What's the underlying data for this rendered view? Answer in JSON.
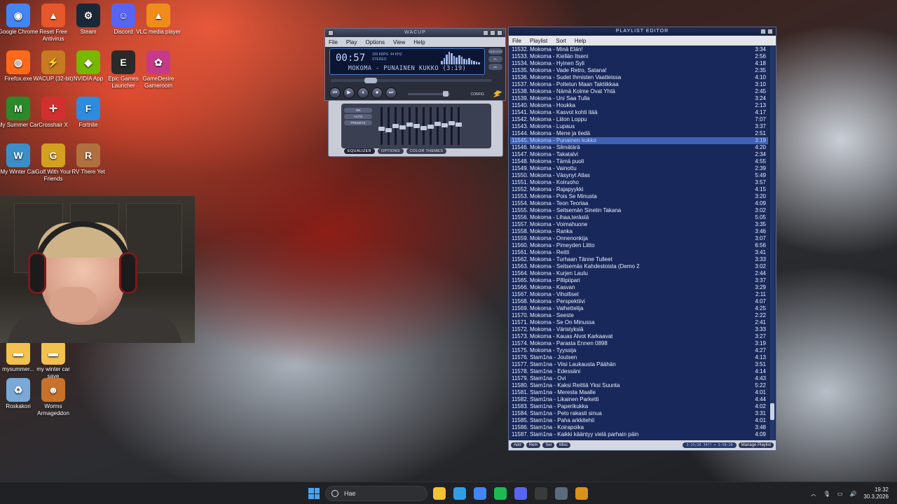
{
  "desktop_icons": [
    {
      "label": "Google Chrome",
      "color": "#4285f4",
      "glyph": "◉"
    },
    {
      "label": "Reset Free Antivirus",
      "color": "#e6572b",
      "glyph": "▲"
    },
    {
      "label": "Steam",
      "color": "#1b2838",
      "glyph": "⚙"
    },
    {
      "label": "Discord",
      "color": "#5865f2",
      "glyph": "☺"
    },
    {
      "label": "VLC media player",
      "color": "#f08c1a",
      "glyph": "▲"
    },
    {
      "label": "Firefox.exe",
      "color": "#ff6a1a",
      "glyph": "◍"
    },
    {
      "label": "WACUP (32-bit)",
      "color": "#c77a20",
      "glyph": "⚡"
    },
    {
      "label": "NVIDIA App",
      "color": "#76b900",
      "glyph": "◆"
    },
    {
      "label": "Epic Games Launcher",
      "color": "#2a2a2a",
      "glyph": "E"
    },
    {
      "label": "GameDesire Gameroom",
      "color": "#c73a8a",
      "glyph": "✿"
    },
    {
      "label": "My Summer Car",
      "color": "#2a8a2a",
      "glyph": "M"
    },
    {
      "label": "Crosshair X",
      "color": "#d23030",
      "glyph": "✛"
    },
    {
      "label": "Fortnite",
      "color": "#2d8be0",
      "glyph": "F"
    },
    {
      "label": "My Winter Car",
      "color": "#3b8fc8",
      "glyph": "W"
    },
    {
      "label": "Golf With Your Friends",
      "color": "#d4a020",
      "glyph": "G"
    },
    {
      "label": "RV There Yet",
      "color": "#b07040",
      "glyph": "R"
    },
    {
      "label": "mysummer...",
      "color": "#f2c14e",
      "glyph": "▬"
    },
    {
      "label": "my winter car save",
      "color": "#f2c14e",
      "glyph": "▬"
    },
    {
      "label": "Roskakori",
      "color": "#7aa9d8",
      "glyph": "♻"
    },
    {
      "label": "Worms Armageddon",
      "color": "#c8712a",
      "glyph": "☻"
    }
  ],
  "winamp": {
    "title": "WACUP",
    "menu": [
      "File",
      "Play",
      "Options",
      "View",
      "Help"
    ],
    "time": "00:57",
    "kbps": "320",
    "khz": "44",
    "mode": "STEREO",
    "song": "MOKOMA - PUNAINEN KUKKO (3:19)",
    "side_buttons": [
      "VIDEO/VIS",
      "PL",
      "ML"
    ],
    "controls": [
      "⏮",
      "▶",
      "⏸",
      "⏹",
      "⏭"
    ],
    "config_label": "CONFIG"
  },
  "equalizer": {
    "left_buttons": [
      "ON",
      "AUTO",
      "PRESETS"
    ],
    "tabs": [
      "EQUALIZER",
      "OPTIONS",
      "COLOR THEMES"
    ]
  },
  "playlist": {
    "title": "PLAYLIST EDITOR",
    "menu": [
      "File",
      "Playlist",
      "Sort",
      "Help"
    ],
    "selected_index": 13,
    "rows": [
      {
        "name": "11532. Mokoma - Minä Elän!",
        "dur": "3:34"
      },
      {
        "name": "11533. Mokoma - Kiellän Itseni",
        "dur": "2:56"
      },
      {
        "name": "11534. Mokoma - Hyinen Syli",
        "dur": "4:18"
      },
      {
        "name": "11535. Mokoma - Vade Retro, Satana!",
        "dur": "2:35"
      },
      {
        "name": "11536. Mokoma - Sudet Ihmisten Vaatteissa",
        "dur": "4:10"
      },
      {
        "name": "11537. Mokoma - Poltetun Maan Taktiikkaa",
        "dur": "3:10"
      },
      {
        "name": "11538. Mokoma - Nämä Kolme Ovat Yhtä",
        "dur": "2:45"
      },
      {
        "name": "11539. Mokoma - Uni Saa Tulla",
        "dur": "3:24"
      },
      {
        "name": "11540. Mokoma - Houkka",
        "dur": "2:13"
      },
      {
        "name": "11541. Mokoma - Kasvot kohti itää",
        "dur": "4:17"
      },
      {
        "name": "11542. Mokoma - Liiton Loppu",
        "dur": "7:07"
      },
      {
        "name": "11543. Mokoma - Lupaus",
        "dur": "3:37"
      },
      {
        "name": "11544. Mokoma - Mene ja tiedä",
        "dur": "2:51"
      },
      {
        "name": "11545. Mokoma - Punainen kukko",
        "dur": "3:19"
      },
      {
        "name": "11546. Mokoma - Silmätärä",
        "dur": "4:20"
      },
      {
        "name": "11547. Mokoma - Takatalvi",
        "dur": "2:34"
      },
      {
        "name": "11548. Mokoma - Tämä puoli",
        "dur": "4:55"
      },
      {
        "name": "11549. Mokoma - Vainottu",
        "dur": "2:39"
      },
      {
        "name": "11550. Mokoma - Väsynyt Atlas",
        "dur": "5:49"
      },
      {
        "name": "11551. Mokoma - Koiruoho",
        "dur": "3:57"
      },
      {
        "name": "11552. Mokoma - Rajapyykki",
        "dur": "4:15"
      },
      {
        "name": "11553. Mokoma - Pois Se Minusta",
        "dur": "3:20"
      },
      {
        "name": "11554. Mokoma - Teon Teoriaa",
        "dur": "4:09"
      },
      {
        "name": "11555. Mokoma - Seitsemän Sinetin Takana",
        "dur": "3:02"
      },
      {
        "name": "11556. Mokoma - Lihaa,terästä",
        "dur": "5:05"
      },
      {
        "name": "11557. Mokoma - Voimahuone",
        "dur": "3:35"
      },
      {
        "name": "11558. Mokoma - Ranka",
        "dur": "3:46"
      },
      {
        "name": "11559. Mokoma - Onnenonkija",
        "dur": "3:07"
      },
      {
        "name": "11560. Mokoma - Pimeyden Liitto",
        "dur": "6:56"
      },
      {
        "name": "11561. Mokoma - Reitti",
        "dur": "3:41"
      },
      {
        "name": "11562. Mokoma - Turhaan Tänne Tulleet",
        "dur": "3:33"
      },
      {
        "name": "11563. Mokoma - Seitsemäs Kahdestoista (Demo 2",
        "dur": "3:02"
      },
      {
        "name": "11564. Mokoma - Kurjen Laulu",
        "dur": "2:44"
      },
      {
        "name": "11565. Mokoma - Pillipiipari",
        "dur": "3:37"
      },
      {
        "name": "11566. Mokoma - Kasvan",
        "dur": "3:29"
      },
      {
        "name": "11567. Mokoma - Viholliset",
        "dur": "2:11"
      },
      {
        "name": "11568. Mokoma - Perspektiivi",
        "dur": "4:07"
      },
      {
        "name": "11569. Mokoma - Valhettelija",
        "dur": "4:25"
      },
      {
        "name": "11570. Mokoma - Seeste",
        "dur": "2:22"
      },
      {
        "name": "11571. Mokoma - Se On Minussa",
        "dur": "2:41"
      },
      {
        "name": "11572. Mokoma - Väristyksiä",
        "dur": "3:33"
      },
      {
        "name": "11573. Mokoma - Kauas Alvot Karkaavat",
        "dur": "3:27"
      },
      {
        "name": "11574. Mokoma - Parasta Ennen 0898",
        "dur": "3:19"
      },
      {
        "name": "11575. Mokoma - Tyyssija",
        "dur": "4:27"
      },
      {
        "name": "11576. Stam1na - Joutsen",
        "dur": "4:13"
      },
      {
        "name": "11577. Stam1na - Viisi Laukausta Päähän",
        "dur": "3:51"
      },
      {
        "name": "11578. Stam1na - Edessäni",
        "dur": "4:14"
      },
      {
        "name": "11579. Stam1na - Ovi",
        "dur": "4:43"
      },
      {
        "name": "11580. Stam1na - Kaksi Reittiä Yksi Suunta",
        "dur": "5:22"
      },
      {
        "name": "11581. Stam1na - Meresta Maalle",
        "dur": "4:01"
      },
      {
        "name": "11582. Stam1na - Likainen Parketti",
        "dur": "4:44"
      },
      {
        "name": "11583. Stam1na - Paperikukka",
        "dur": "4:02"
      },
      {
        "name": "11584. Stam1na - Peto rakasti sinua",
        "dur": "3:31"
      },
      {
        "name": "11585. Stam1na - Paha arkkitehti",
        "dur": "4:01"
      },
      {
        "name": "11586. Stam1na - Koirapoika",
        "dur": "3:48"
      },
      {
        "name": "11587. Stam1na - Kaikki kääntyy vielä parhain päin",
        "dur": "4:09"
      }
    ],
    "bottom_buttons": [
      "Add",
      "Rem",
      "Sel",
      "Misc"
    ],
    "total_info": "3:15/28 34?? + 3:58:28",
    "manage_label": "Manage Playlist"
  },
  "taskbar": {
    "search_placeholder": "Hae",
    "time": "19.32",
    "date": "30.3.2026",
    "apps": [
      {
        "name": "file-explorer",
        "color": "#f4c430"
      },
      {
        "name": "edge",
        "color": "#2f9ee8"
      },
      {
        "name": "chrome",
        "color": "#4285f4"
      },
      {
        "name": "spotify",
        "color": "#1db954"
      },
      {
        "name": "discord",
        "color": "#5865f2"
      },
      {
        "name": "obs",
        "color": "#3a3a3a"
      },
      {
        "name": "steam",
        "color": "#5a6b7d"
      },
      {
        "name": "winamp",
        "color": "#d9921c"
      }
    ]
  }
}
